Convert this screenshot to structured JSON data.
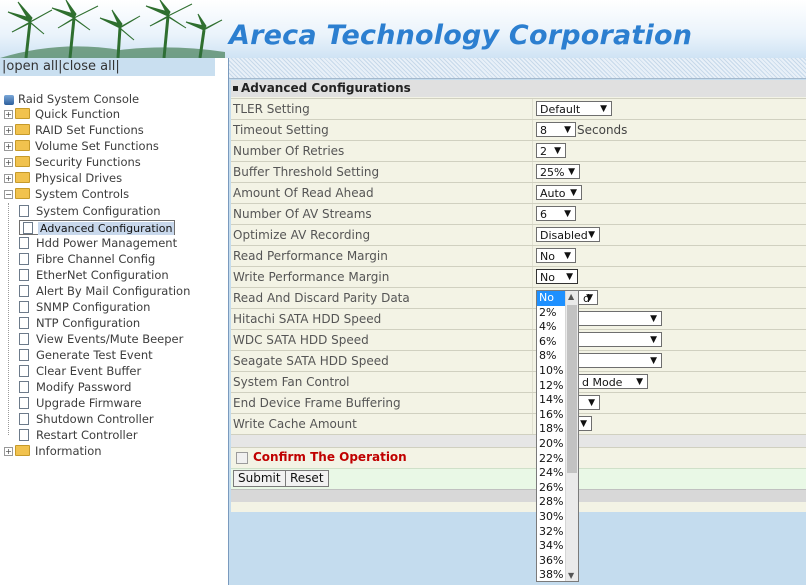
{
  "header": {
    "brand": "Areca Technology Corporation"
  },
  "sidebar": {
    "open_all": "open all",
    "close_all": "close all",
    "root": "Raid System Console",
    "folders": [
      {
        "label": "Quick Function"
      },
      {
        "label": "RAID Set Functions"
      },
      {
        "label": "Volume Set Functions"
      },
      {
        "label": "Security Functions"
      },
      {
        "label": "Physical Drives"
      },
      {
        "label": "System Controls"
      }
    ],
    "children": [
      {
        "label": "System Configuration"
      },
      {
        "label": "Advanced Configuration"
      },
      {
        "label": "Hdd Power Management"
      },
      {
        "label": "Fibre Channel Config"
      },
      {
        "label": "EtherNet Configuration"
      },
      {
        "label": "Alert By Mail Configuration"
      },
      {
        "label": "SNMP Configuration"
      },
      {
        "label": "NTP Configuration"
      },
      {
        "label": "View Events/Mute Beeper"
      },
      {
        "label": "Generate Test Event"
      },
      {
        "label": "Clear Event Buffer"
      },
      {
        "label": "Modify Password"
      },
      {
        "label": "Upgrade Firmware"
      },
      {
        "label": "Shutdown Controller"
      },
      {
        "label": "Restart Controller"
      }
    ],
    "information": "Information"
  },
  "form": {
    "title": "Advanced Configurations",
    "rows": [
      {
        "label": "TLER Setting",
        "value": "Default",
        "unit": ""
      },
      {
        "label": "Timeout Setting",
        "value": "8",
        "unit": "Seconds"
      },
      {
        "label": "Number Of Retries",
        "value": "2",
        "unit": ""
      },
      {
        "label": "Buffer Threshold Setting",
        "value": "25%",
        "unit": ""
      },
      {
        "label": "Amount Of Read Ahead",
        "value": "Auto",
        "unit": ""
      },
      {
        "label": "Number Of AV Streams",
        "value": "6",
        "unit": ""
      },
      {
        "label": "Optimize AV Recording",
        "value": "Disabled",
        "unit": ""
      },
      {
        "label": "Read Performance Margin",
        "value": "No",
        "unit": ""
      },
      {
        "label": "Write Performance Margin",
        "value": "No",
        "unit": ""
      },
      {
        "label": "Read And Discard Parity Data",
        "value": "d",
        "unit": ""
      },
      {
        "label": "Hitachi SATA HDD Speed",
        "value": "",
        "unit": ""
      },
      {
        "label": "WDC SATA HDD Speed",
        "value": "",
        "unit": ""
      },
      {
        "label": "Seagate SATA HDD Speed",
        "value": "",
        "unit": ""
      },
      {
        "label": "System Fan Control",
        "value": "d Mode",
        "unit": ""
      },
      {
        "label": "End Device Frame Buffering",
        "value": "",
        "unit": ""
      },
      {
        "label": "Write Cache Amount",
        "value": "",
        "unit": ""
      }
    ],
    "confirm": "Confirm The Operation",
    "submit": "Submit",
    "reset": "Reset"
  },
  "dropdown_options": [
    "No",
    "2%",
    "4%",
    "6%",
    "8%",
    "10%",
    "12%",
    "14%",
    "16%",
    "18%",
    "20%",
    "22%",
    "24%",
    "26%",
    "28%",
    "30%",
    "32%",
    "34%",
    "36%",
    "38%"
  ],
  "dropdown_selected": "No",
  "colors": {
    "brand": "#2c7fd0",
    "highlight": "#1e90ff",
    "confirm": "#c00000"
  }
}
